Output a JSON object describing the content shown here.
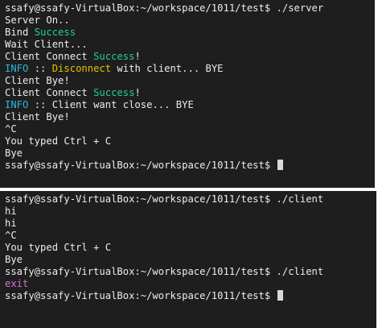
{
  "colors": {
    "background": "#1e1e1e",
    "foreground": "#ececec",
    "success": "#23d18b",
    "info": "#29b8db",
    "warning": "#e5c100",
    "magenta": "#d670d6"
  },
  "top_terminal": {
    "lines": [
      [
        {
          "text": "ssafy@ssafy-VirtualBox:~/workspace/1011/test$ ./server",
          "color": "#ececec"
        }
      ],
      [
        {
          "text": "Server On..",
          "color": "#ececec"
        }
      ],
      [
        {
          "text": "Bind ",
          "color": "#ececec"
        },
        {
          "text": "Success",
          "color": "#23d18b"
        }
      ],
      [
        {
          "text": "Wait Client...",
          "color": "#ececec"
        }
      ],
      [
        {
          "text": "Client Connect ",
          "color": "#ececec"
        },
        {
          "text": "Success",
          "color": "#23d18b"
        },
        {
          "text": "!",
          "color": "#ececec"
        }
      ],
      [
        {
          "text": "INFO",
          "color": "#29b8db"
        },
        {
          "text": " :: ",
          "color": "#ececec"
        },
        {
          "text": "Disconnect",
          "color": "#e5c100"
        },
        {
          "text": " with client... BYE",
          "color": "#ececec"
        }
      ],
      [
        {
          "text": "Client Bye!",
          "color": "#ececec"
        }
      ],
      [
        {
          "text": "Client Connect ",
          "color": "#ececec"
        },
        {
          "text": "Success",
          "color": "#23d18b"
        },
        {
          "text": "!",
          "color": "#ececec"
        }
      ],
      [
        {
          "text": "INFO",
          "color": "#29b8db"
        },
        {
          "text": " :: Client want close... BYE",
          "color": "#ececec"
        }
      ],
      [
        {
          "text": "Client Bye!",
          "color": "#ececec"
        }
      ],
      [
        {
          "text": "^C",
          "color": "#ececec"
        }
      ],
      [
        {
          "text": "You typed Ctrl + C",
          "color": "#ececec"
        }
      ],
      [
        {
          "text": "Bye",
          "color": "#ececec"
        }
      ],
      [
        {
          "text": "ssafy@ssafy-VirtualBox:~/workspace/1011/test$ ",
          "color": "#ececec"
        }
      ]
    ]
  },
  "bottom_terminal": {
    "lines": [
      [
        {
          "text": "ssafy@ssafy-VirtualBox:~/workspace/1011/test$ ./client",
          "color": "#ececec"
        }
      ],
      [
        {
          "text": "hi",
          "color": "#ececec"
        }
      ],
      [
        {
          "text": "hi",
          "color": "#ececec"
        }
      ],
      [
        {
          "text": "^C",
          "color": "#ececec"
        }
      ],
      [
        {
          "text": "You typed Ctrl + C",
          "color": "#ececec"
        }
      ],
      [
        {
          "text": "Bye",
          "color": "#ececec"
        }
      ],
      [
        {
          "text": "ssafy@ssafy-VirtualBox:~/workspace/1011/test$ ./client",
          "color": "#ececec"
        }
      ],
      [
        {
          "text": "exit",
          "color": "#d670d6"
        }
      ],
      [
        {
          "text": "ssafy@ssafy-VirtualBox:~/workspace/1011/test$ ",
          "color": "#ececec"
        }
      ]
    ]
  }
}
